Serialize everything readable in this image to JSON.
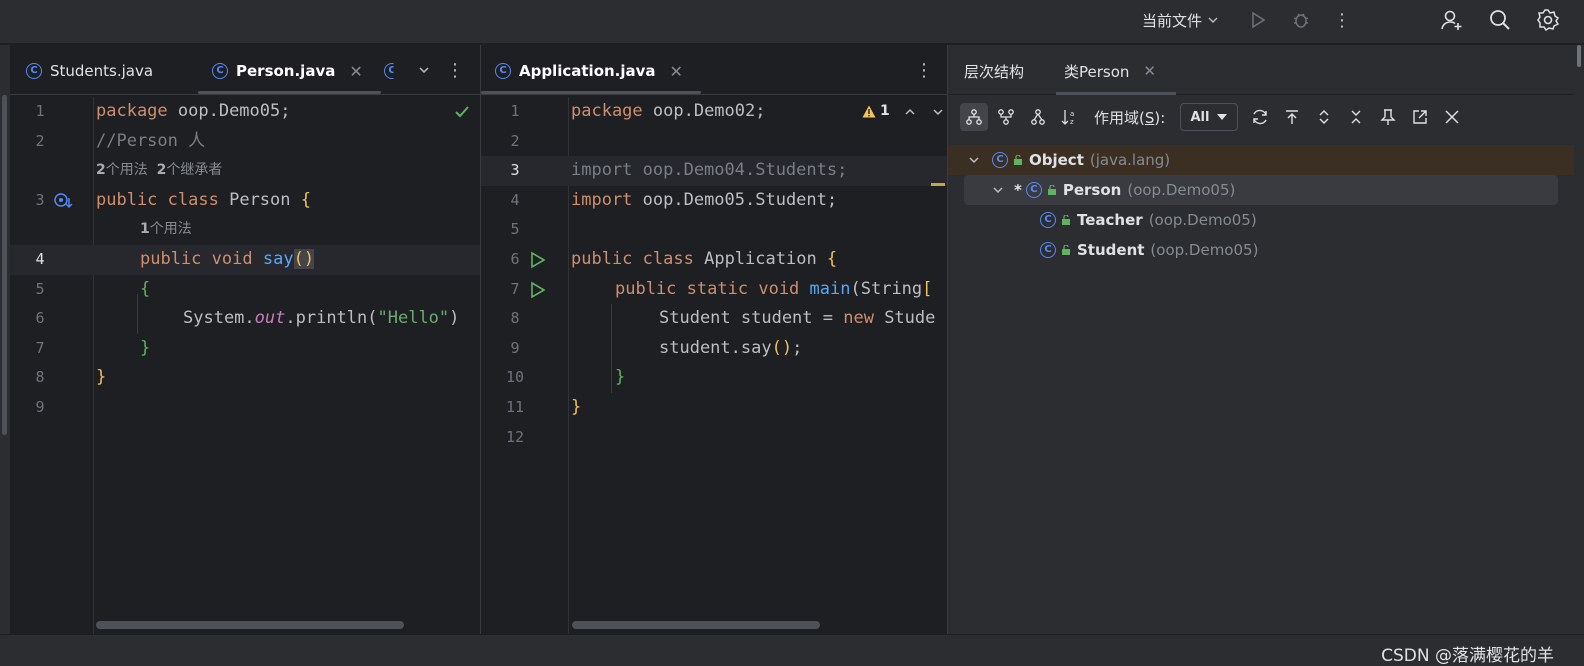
{
  "toolbar": {
    "current_file_label": "当前文件",
    "run_icon": "run-icon",
    "debug_icon": "debug-icon",
    "more_icon": "more-vertical-icon",
    "user_icon": "add-user-icon",
    "search_icon": "search-icon",
    "settings_icon": "gear-icon"
  },
  "left_editor": {
    "tabs": [
      {
        "label": "Students.java",
        "icon": "class-icon"
      },
      {
        "label": "Person.java",
        "icon": "class-icon",
        "active": true
      }
    ],
    "tab_overflow_icon": "class-icon",
    "lines": [
      {
        "n": "1",
        "code": "package oop.Demo05;"
      },
      {
        "n": "2",
        "code": "//Person 人"
      },
      {
        "hint": "2个用法  2个继承者"
      },
      {
        "n": "3",
        "code": "public class Person {"
      },
      {
        "hint": "1个用法"
      },
      {
        "n": "4",
        "code": "public void say()"
      },
      {
        "n": "5",
        "code": "{"
      },
      {
        "n": "6",
        "code": "System.out.println(\"Hello\")"
      },
      {
        "n": "7",
        "code": "}"
      },
      {
        "n": "8",
        "code": "}"
      },
      {
        "n": "9",
        "code": ""
      }
    ],
    "hints": {
      "usages_count_a": "2",
      "usages_label_a": "个用法",
      "inheritors_count": "2",
      "inheritors_label": "个继承者",
      "usages_count_b": "1",
      "usages_label_b": "个用法"
    },
    "tokens": {
      "package": "package",
      "pkg_name": " oop.Demo05;",
      "comment": "//Person 人",
      "public": "public",
      "class": "class",
      "class_name": " Person ",
      "void": "void",
      "say": "say",
      "paren": "()",
      "open_brace": "{",
      "close_brace": "}",
      "system": "System.",
      "out": "out",
      "println": ".println(",
      "hello": "\"Hello\"",
      "close_paren": ")"
    }
  },
  "right_editor": {
    "tabs": [
      {
        "label": "Application.java",
        "icon": "class-icon",
        "active": true
      }
    ],
    "warning_count": "1",
    "tokens": {
      "package": "package",
      "pkg_name": " oop.Demo02;",
      "import1": "import oop.Demo04.Students;",
      "import_kw": "import",
      "import2": " oop.Demo05.Student;",
      "public": "public",
      "class": "class",
      "class_name": " Application ",
      "static": "static",
      "void": "void",
      "main": "main",
      "main_rest": "(String",
      "student_decl": "Student student = ",
      "new": "new",
      "student_ctor": " Stude",
      "say_call": "student.say",
      "paren": "()",
      "semi": ";",
      "open_brace": "{",
      "close_brace": "}",
      "open_bracket": "["
    },
    "line_numbers": [
      "1",
      "2",
      "3",
      "4",
      "5",
      "6",
      "7",
      "8",
      "9",
      "10",
      "11",
      "12"
    ]
  },
  "tool_window": {
    "tabs": [
      {
        "label": "层次结构"
      },
      {
        "label": "类Person",
        "active": true
      }
    ],
    "scope_label_prefix": "作用域(",
    "scope_label_key": "S",
    "scope_label_suffix": "):",
    "scope_value": "All",
    "tree": [
      {
        "name": "Object",
        "pkg": "(java.lang)",
        "depth": 0,
        "expanded": true
      },
      {
        "name": "Person",
        "pkg": "(oop.Demo05)",
        "depth": 1,
        "expanded": true,
        "marker": "*"
      },
      {
        "name": "Teacher",
        "pkg": "(oop.Demo05)",
        "depth": 2
      },
      {
        "name": "Student",
        "pkg": "(oop.Demo05)",
        "depth": 2
      }
    ]
  },
  "watermark": "CSDN @落满樱花的羊",
  "colors": {
    "background": "#1e1f22",
    "panel": "#2b2d30",
    "keyword": "#cf8e6d",
    "function": "#56a8f5",
    "string": "#6aab73",
    "class_icon": "#548af7",
    "run_green": "#5fb35f"
  }
}
